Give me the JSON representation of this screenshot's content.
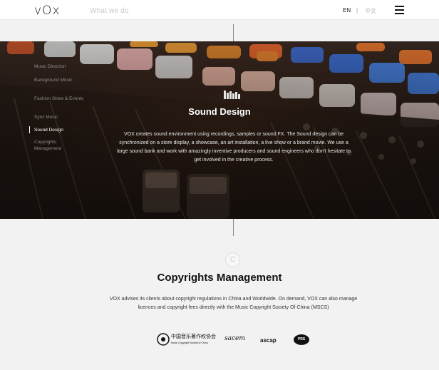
{
  "header": {
    "logo": "vOx",
    "section_title": "What we do",
    "lang_en": "EN",
    "lang_sep": "|",
    "lang_zh": "中文",
    "menu_icon": "hamburger-menu-icon"
  },
  "sidebar": {
    "items": [
      {
        "label": "Music Direction",
        "active": false
      },
      {
        "label": "Background Music",
        "active": false
      },
      {
        "label": "Fashion Show & Events",
        "active": false
      },
      {
        "label": "Sync Music",
        "active": false
      },
      {
        "label": "Sound Design",
        "active": true
      },
      {
        "label": "Copyrights Management",
        "active": false
      }
    ]
  },
  "sound_design": {
    "icon": "equalizer-icon",
    "title": "Sound Design",
    "paragraph": "VOX creates sound environment using recordings, samples or sound FX. The Sound design can be synchronized on a store display, a showcase, an art installation, a live show or a brand movie. We use a large sound bank and work with amazingly inventive producers and sound engineers who don't hesitate to get involved in the creative process."
  },
  "copyrights": {
    "icon_letter": "C",
    "title": "Copyrights Management",
    "paragraph": "VOX advises its clients about copyright regulations in China and Worldwide. On demand, VOX can also manage licences and copyright fees directly with the Music Copyright Society Of China (MSCS)",
    "logos": {
      "mcsc_name": "中国音乐著作权协会",
      "mcsc_caption": "Music Copyright Society of China",
      "sacem": "sacem",
      "ascap": "ascap",
      "prs": "PRS"
    }
  },
  "colors": {
    "accent": "#ffffff",
    "text_dark": "#111111",
    "muted": "#8c8c8c"
  }
}
